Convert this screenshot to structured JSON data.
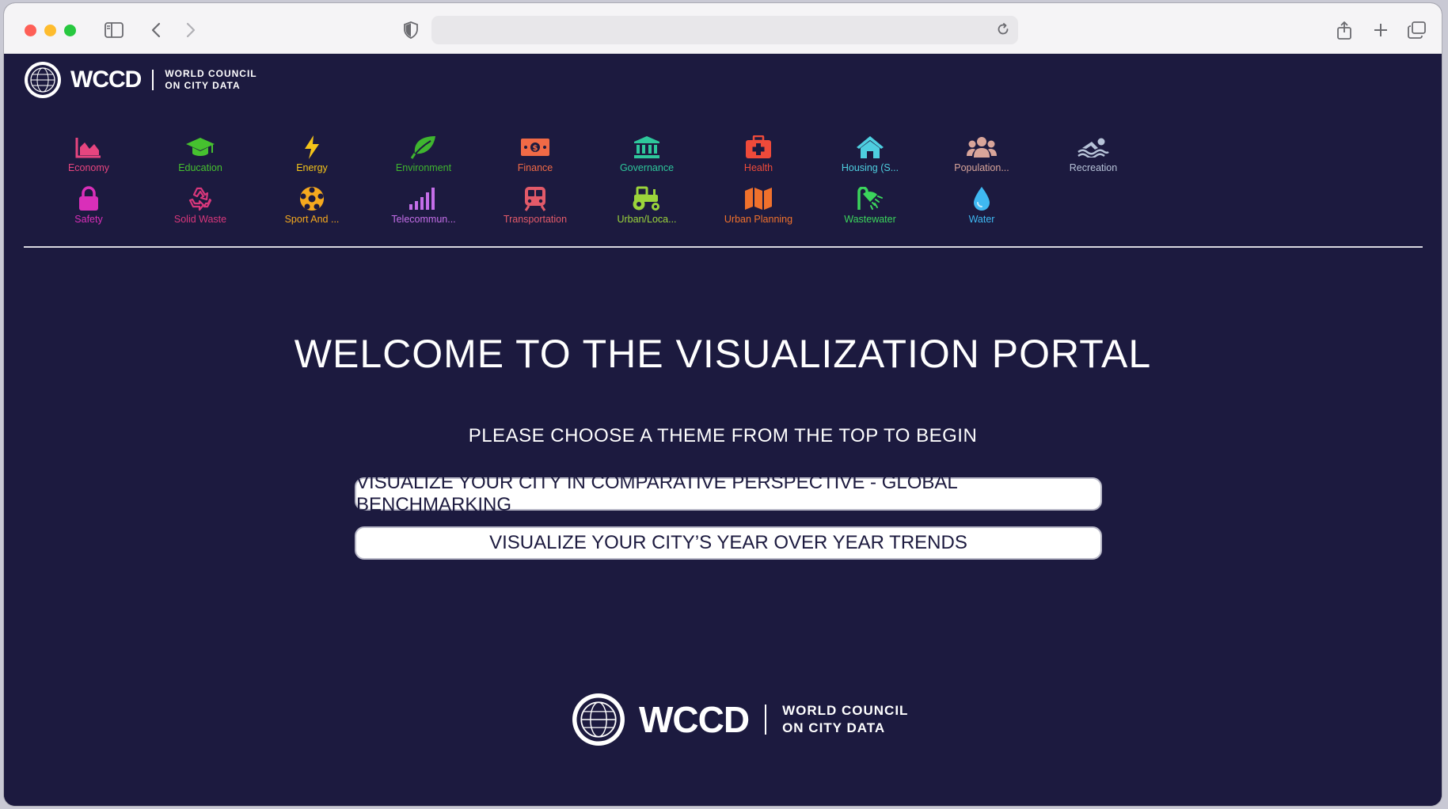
{
  "brand": {
    "wordmark": "WCCD",
    "line1": "WORLD COUNCIL",
    "line2": "ON CITY DATA"
  },
  "themes": [
    {
      "label": "Economy",
      "icon": "chart-area-icon",
      "color": "#e6457f"
    },
    {
      "label": "Education",
      "icon": "graduation-cap-icon",
      "color": "#46c12f"
    },
    {
      "label": "Energy",
      "icon": "lightning-bolt-icon",
      "color": "#f5c419"
    },
    {
      "label": "Environment",
      "icon": "leaf-icon",
      "color": "#3fb52f"
    },
    {
      "label": "Finance",
      "icon": "money-bill-icon",
      "color": "#f16a46"
    },
    {
      "label": "Governance",
      "icon": "landmark-icon",
      "color": "#2ec79b"
    },
    {
      "label": "Health",
      "icon": "medical-kit-icon",
      "color": "#ef4a3a"
    },
    {
      "label": "Housing (S...",
      "icon": "house-icon",
      "color": "#4ecfe0"
    },
    {
      "label": "Population...",
      "icon": "people-icon",
      "color": "#d9a59a"
    },
    {
      "label": "Recreation",
      "icon": "swimmer-icon",
      "color": "#b7c3d8"
    },
    {
      "label": "Safety",
      "icon": "lock-icon",
      "color": "#d92fb9"
    },
    {
      "label": "Solid Waste",
      "icon": "recycle-icon",
      "color": "#d8377b"
    },
    {
      "label": "Sport And ...",
      "icon": "ball-icon",
      "color": "#f5a91e"
    },
    {
      "label": "Telecommun...",
      "icon": "signal-bars-icon",
      "color": "#c46ee8"
    },
    {
      "label": "Transportation",
      "icon": "subway-icon",
      "color": "#e25a69"
    },
    {
      "label": "Urban/Loca...",
      "icon": "tractor-icon",
      "color": "#9bd43b"
    },
    {
      "label": "Urban Planning",
      "icon": "map-icon",
      "color": "#f0712c"
    },
    {
      "label": "Wastewater",
      "icon": "shower-icon",
      "color": "#3bd45c"
    },
    {
      "label": "Water",
      "icon": "water-drop-icon",
      "color": "#3fb8f2"
    }
  ],
  "main": {
    "welcome": "WELCOME TO THE VISUALIZATION PORTAL",
    "subtitle": "PLEASE CHOOSE A THEME FROM THE TOP TO BEGIN",
    "cta_benchmark": "VISUALIZE YOUR CITY IN COMPARATIVE PERSPECTIVE -  GLOBAL BENCHMARKING",
    "cta_trends": "VISUALIZE YOUR CITY’S YEAR OVER YEAR TRENDS"
  }
}
